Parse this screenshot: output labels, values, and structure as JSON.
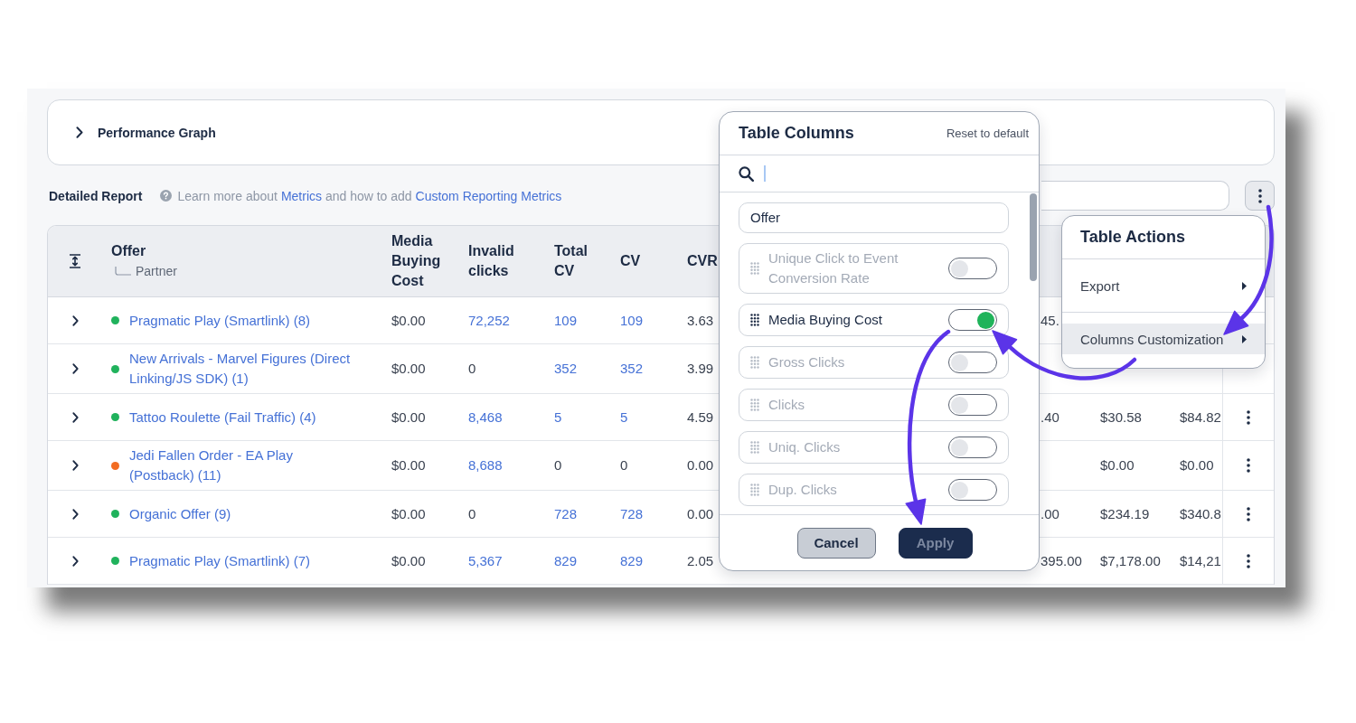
{
  "performance_graph": {
    "title": "Performance Graph",
    "expanded": false
  },
  "report": {
    "title": "Detailed Report",
    "help_text": [
      {
        "kind": "text",
        "text": "Learn more about "
      },
      {
        "kind": "link",
        "text": "Metrics"
      },
      {
        "kind": "text",
        "text": " and how to add "
      },
      {
        "kind": "link",
        "text": "Custom Reporting Metrics"
      }
    ]
  },
  "table": {
    "columns": [
      {
        "label": "Offer",
        "sublabel": "Partner"
      },
      {
        "label": "Media Buying Cost"
      },
      {
        "label": "Invalid clicks"
      },
      {
        "label": "Total CV"
      },
      {
        "label": "CV"
      },
      {
        "label": "CVR"
      }
    ],
    "rows": [
      {
        "expanded": false,
        "color": "#20b25c",
        "offer": "Pragmatic Play (Smartlink) (8)",
        "media_buying_cost": "$0.00",
        "invalid_clicks": {
          "text": "72,252",
          "link": true
        },
        "total_cv": {
          "text": "109",
          "link": true
        },
        "cv": {
          "text": "109",
          "link": true
        },
        "cvr": "3.63",
        "column_9": "45.",
        "menu_button": false
      },
      {
        "expanded": false,
        "color": "#20b25c",
        "offer": "New Arrivals - Marvel Figures (Direct Linking/JS SDK) (1)",
        "media_buying_cost": "$0.00",
        "invalid_clicks": {
          "text": "0",
          "link": false
        },
        "total_cv": {
          "text": "352",
          "link": true
        },
        "cv": {
          "text": "352",
          "link": true
        },
        "cvr": "3.99",
        "menu_button": false
      },
      {
        "expanded": false,
        "color": "#20b25c",
        "offer": "Tattoo Roulette (Fail Traffic) (4)",
        "media_buying_cost": "$0.00",
        "invalid_clicks": {
          "text": "8,468",
          "link": true
        },
        "total_cv": {
          "text": "5",
          "link": true
        },
        "cv": {
          "text": "5",
          "link": true
        },
        "cvr": "4.59",
        "column_9": ".40",
        "column_10": "$30.58",
        "column_11": "$84.82",
        "menu_button": true
      },
      {
        "expanded": false,
        "color": "#f26c22",
        "offer": "Jedi Fallen Order - EA Play (Postback) (11)",
        "media_buying_cost": "$0.00",
        "invalid_clicks": {
          "text": "8,688",
          "link": true
        },
        "total_cv": {
          "text": "0",
          "link": false
        },
        "cv": {
          "text": "0",
          "link": false
        },
        "cvr": "0.00",
        "column_10": "$0.00",
        "column_11": "$0.00",
        "menu_button": true
      },
      {
        "expanded": false,
        "color": "#20b25c",
        "offer": "Organic Offer (9)",
        "media_buying_cost": "$0.00",
        "invalid_clicks": {
          "text": "0",
          "link": false
        },
        "total_cv": {
          "text": "728",
          "link": true
        },
        "cv": {
          "text": "728",
          "link": true
        },
        "cvr": "0.00",
        "column_9": ".00",
        "column_10": "$234.19",
        "column_11": "$340.8",
        "menu_button": true
      },
      {
        "expanded": false,
        "color": "#20b25c",
        "offer": "Pragmatic Play (Smartlink) (7)",
        "media_buying_cost": "$0.00",
        "invalid_clicks": {
          "text": "5,367",
          "link": true
        },
        "total_cv": {
          "text": "829",
          "link": true
        },
        "cv": {
          "text": "829",
          "link": true
        },
        "cvr": "2.05",
        "column_9": "395.00",
        "column_10": "$7,178.00",
        "column_11": "$14,21",
        "menu_button": true
      }
    ]
  },
  "table_columns_dialog": {
    "title": "Table Columns",
    "reset_label": "Reset to default",
    "search": {
      "focused": true
    },
    "items": [
      {
        "kind": "fixed",
        "label": "Offer"
      },
      {
        "kind": "toggle",
        "label": "Unique Click to Event Conversion Rate",
        "on": false
      },
      {
        "kind": "toggle",
        "label": "Media Buying Cost",
        "on": true
      },
      {
        "kind": "toggle",
        "label": "Gross Clicks",
        "on": false
      },
      {
        "kind": "toggle",
        "label": "Clicks",
        "on": false
      },
      {
        "kind": "toggle",
        "label": "Uniq. Clicks",
        "on": false
      },
      {
        "kind": "toggle",
        "label": "Dup. Clicks",
        "on": false
      }
    ],
    "buttons": [
      {
        "label": "Cancel",
        "kind": "secondary",
        "disabled": false
      },
      {
        "label": "Apply",
        "kind": "primary",
        "disabled": true
      }
    ]
  },
  "table_actions_menu": {
    "title": "Table Actions",
    "items": [
      {
        "label": "Export",
        "selected": false
      },
      {
        "label": "Columns Customization",
        "selected": true
      }
    ]
  }
}
